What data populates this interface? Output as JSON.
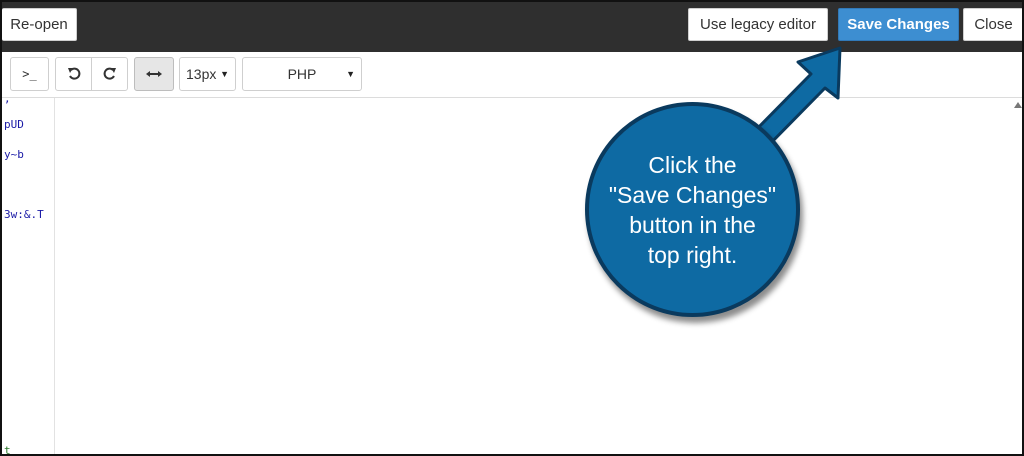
{
  "header": {
    "reopen_label": "Re-open",
    "legacy_label": "Use legacy editor",
    "save_label": "Save Changes",
    "close_label": "Close"
  },
  "toolbar": {
    "terminal_label": ">_",
    "undo_icon": "undo-icon",
    "redo_icon": "redo-icon",
    "wrap_icon": "wrap-icon",
    "font_size": "13px",
    "language": "PHP"
  },
  "editor": {
    "gutter_lines": [
      ",",
      "pUD",
      "y~b",
      "3w:&.T",
      "t"
    ]
  },
  "callout": {
    "line1": "Click the",
    "line2": "\"Save Changes\"",
    "line3": "button in the",
    "line4": "top right."
  },
  "colors": {
    "topbar": "#2f2f2f",
    "save_button": "#3d8ed1",
    "callout_fill": "#0e6aa3",
    "callout_border": "#0a3a5e"
  }
}
